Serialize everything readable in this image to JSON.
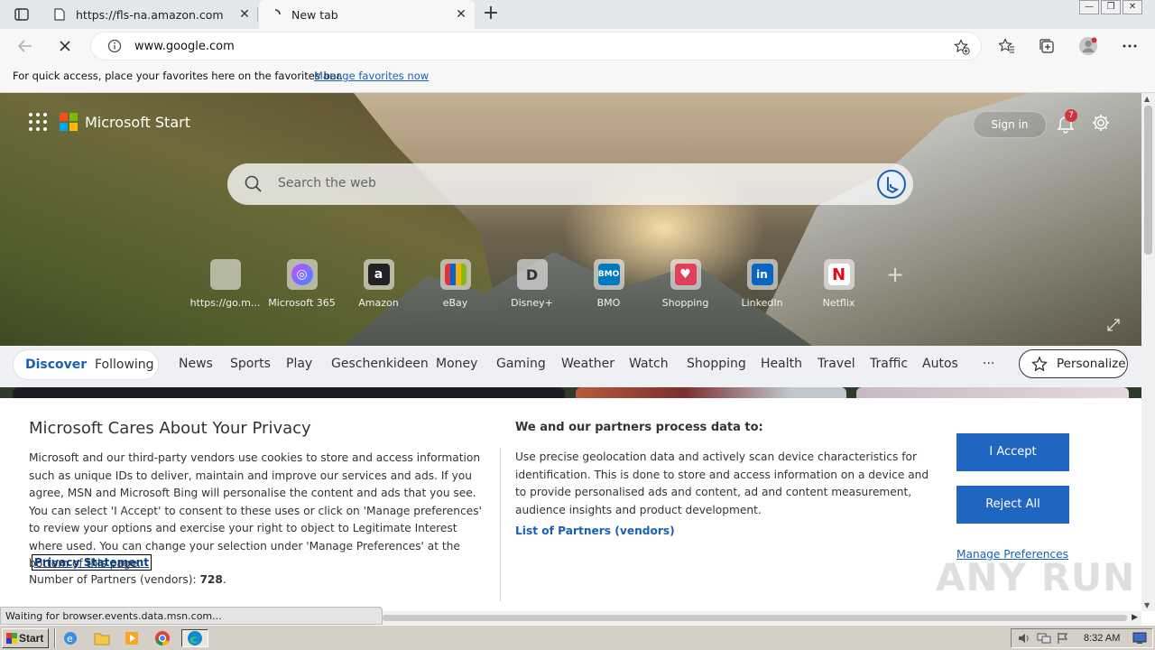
{
  "tabs": [
    {
      "title": "https://fls-na.amazon.com"
    },
    {
      "title": "New tab"
    }
  ],
  "address": {
    "url": "www.google.com"
  },
  "favorites_bar": {
    "message": "For quick access, place your favorites here on the favorites bar.",
    "link": "Manage favorites now"
  },
  "header": {
    "brand": "Microsoft Start",
    "signin": "Sign in",
    "notification_count": "7"
  },
  "search": {
    "placeholder": "Search the web"
  },
  "tiles": [
    {
      "label": "https://go.m...",
      "icon": "microsoft-logo-icon",
      "color": "#ffffff"
    },
    {
      "label": "Microsoft 365",
      "icon": "microsoft-365-icon",
      "color": "#7b61ff"
    },
    {
      "label": "Amazon",
      "icon": "amazon-icon",
      "color": "#222222"
    },
    {
      "label": "eBay",
      "icon": "ebay-icon",
      "color": "#333333"
    },
    {
      "label": "Disney+",
      "icon": "disney-plus-icon",
      "color": "#555555"
    },
    {
      "label": "BMO",
      "icon": "bmo-icon",
      "color": "#0079c1"
    },
    {
      "label": "Shopping",
      "icon": "shopping-bag-icon",
      "color": "#e0405a"
    },
    {
      "label": "LinkedIn",
      "icon": "linkedin-icon",
      "color": "#0a66c2"
    },
    {
      "label": "Netflix",
      "icon": "netflix-icon",
      "color": "#e50914"
    }
  ],
  "feed": {
    "discover": "Discover",
    "following": "Following",
    "categories": [
      "News",
      "Sports",
      "Play",
      "Geschenkideen",
      "Money",
      "Gaming",
      "Weather",
      "Watch",
      "Shopping",
      "Health",
      "Travel",
      "Traffic",
      "Autos",
      "···"
    ],
    "personalize": "Personalize"
  },
  "privacy": {
    "title": "Microsoft Cares About Your Privacy",
    "body": "Microsoft and our third-party vendors use cookies to store and access information such as unique IDs to deliver, maintain and improve our services and ads. If you agree, MSN and Microsoft Bing will personalise the content and ads that you see. You can select 'I Accept' to consent to these uses or click on 'Manage preferences' to review your options and exercise your right to object to Legitimate Interest where used.  You can change your selection under 'Manage Preferences' at the bottom of this page.",
    "statement_link": "Privacy Statement",
    "partners_label": "Number of Partners (vendors): ",
    "partners_count": "728",
    "partners_suffix": ".",
    "process_title": "We and our partners process data to:",
    "process_body": "Use precise geolocation data and actively scan device characteristics for identification. This is done to store and access information on a device and to provide personalised ads and content, ad and content measurement, audience insights and product development.",
    "partners_link": "List of Partners (vendors)",
    "accept": "I Accept",
    "reject": "Reject All",
    "manage": "Manage Preferences",
    "watermark": "ANY RUN"
  },
  "status_text": "Waiting for browser.events.data.msn.com...",
  "taskbar": {
    "start": "Start",
    "time": "8:32 AM"
  },
  "colors": {
    "accent": "#1f66c1",
    "link": "#1a5fb4"
  }
}
